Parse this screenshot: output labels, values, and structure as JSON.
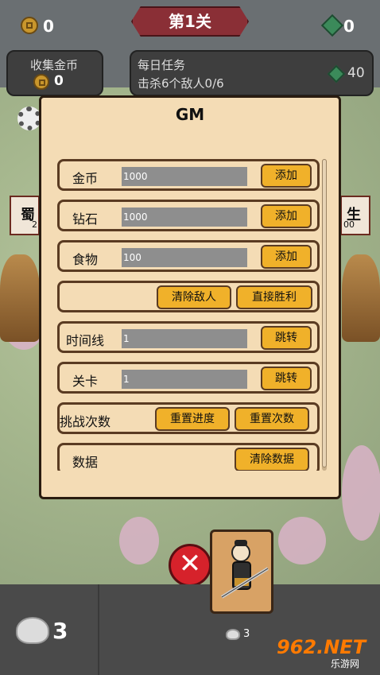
{
  "top_bar": {
    "coins": "0",
    "level_title": "第1关",
    "gems": "0"
  },
  "collect_panel": {
    "label": "收集金币",
    "value": "0"
  },
  "daily_task": {
    "label": "每日任务",
    "task": "击杀6个敌人0/6",
    "reward": "40"
  },
  "side_signs": {
    "left": "蜀",
    "left_sub": "2",
    "right": "生",
    "right_sub": "00"
  },
  "gm_dialog": {
    "title": "GM",
    "rows": [
      {
        "label": "金币",
        "value": "1000",
        "button": "添加"
      },
      {
        "label": "钻石",
        "value": "1000",
        "button": "添加"
      },
      {
        "label": "食物",
        "value": "100",
        "button": "添加"
      },
      {
        "buttons": [
          "清除敌人",
          "直接胜利"
        ]
      },
      {
        "label": "时间线",
        "value": "1",
        "button": "跳转"
      },
      {
        "label": "关卡",
        "value": "1",
        "button": "跳转"
      },
      {
        "label": "挑战次数",
        "buttons": [
          "重置进度",
          "重置次数"
        ]
      },
      {
        "label": "数据",
        "button": "清除数据"
      }
    ]
  },
  "bottom": {
    "food_count": "3",
    "card_cost": "3"
  },
  "watermark": {
    "text": "962.NET",
    "sub": "乐游网"
  },
  "colors": {
    "dialog_bg": "#f4dcb5",
    "button_bg": "#f0b12a",
    "input_bg": "#8e8e8e",
    "close_red": "#d6222b"
  }
}
